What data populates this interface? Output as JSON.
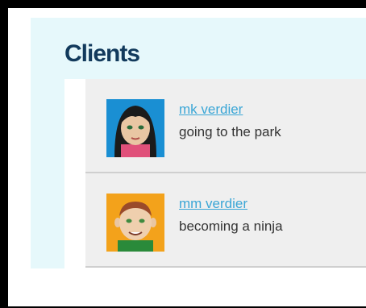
{
  "page": {
    "title": "Clients"
  },
  "clients": [
    {
      "name": "mk verdier",
      "status": "going to the park"
    },
    {
      "name": "mm verdier",
      "status": "becoming a ninja"
    }
  ],
  "colors": {
    "panel_bg": "#e6f8fb",
    "title": "#123a5c",
    "link": "#3aa6d6"
  },
  "icons": [
    "avatar-female-icon",
    "avatar-male-icon"
  ]
}
